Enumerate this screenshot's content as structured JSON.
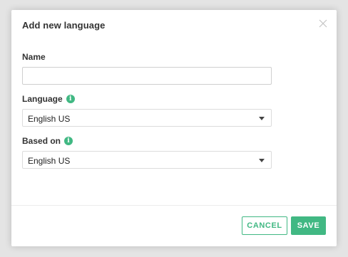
{
  "dialog": {
    "title": "Add new language",
    "close_icon": "close-icon"
  },
  "form": {
    "name": {
      "label": "Name",
      "value": "",
      "placeholder": ""
    },
    "language": {
      "label": "Language",
      "info_icon": "info-icon",
      "info_glyph": "i",
      "selected": "English US"
    },
    "based_on": {
      "label": "Based on",
      "info_icon": "info-icon",
      "info_glyph": "i",
      "selected": "English US"
    }
  },
  "actions": {
    "cancel_label": "CANCEL",
    "save_label": "SAVE"
  },
  "colors": {
    "accent": "#41b883",
    "backdrop": "#e4e4e4",
    "text": "#333333"
  }
}
